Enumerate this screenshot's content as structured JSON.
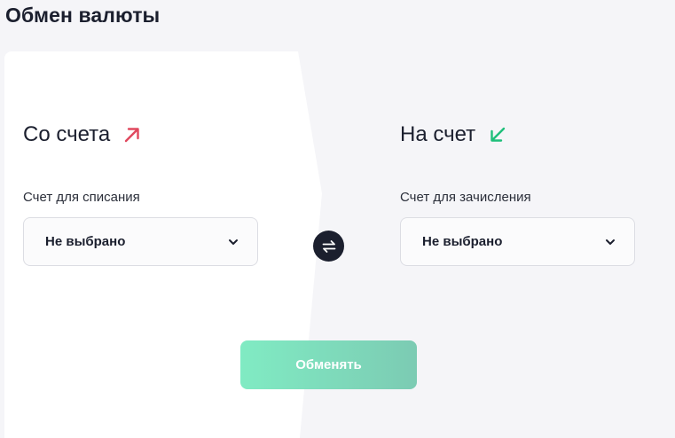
{
  "page": {
    "title": "Обмен валюты"
  },
  "from": {
    "title": "Со счета",
    "field_label": "Счет для списания",
    "selected": "Не выбрано",
    "arrow_icon": "arrow-up-right-icon",
    "arrow_color": "#e0485e"
  },
  "to": {
    "title": "На счет",
    "field_label": "Счет для зачисления",
    "selected": "Не выбрано",
    "arrow_icon": "arrow-down-left-icon",
    "arrow_color": "#1fbf7a"
  },
  "actions": {
    "swap_icon": "swap-arrows-icon",
    "exchange_label": "Обменять"
  },
  "colors": {
    "text_primary": "#1b1f2e",
    "card_left": "#ffffff",
    "card_right": "#f5f5f8",
    "button_gradient_start": "#80ebc3",
    "button_gradient_end": "#7ccbb3"
  }
}
